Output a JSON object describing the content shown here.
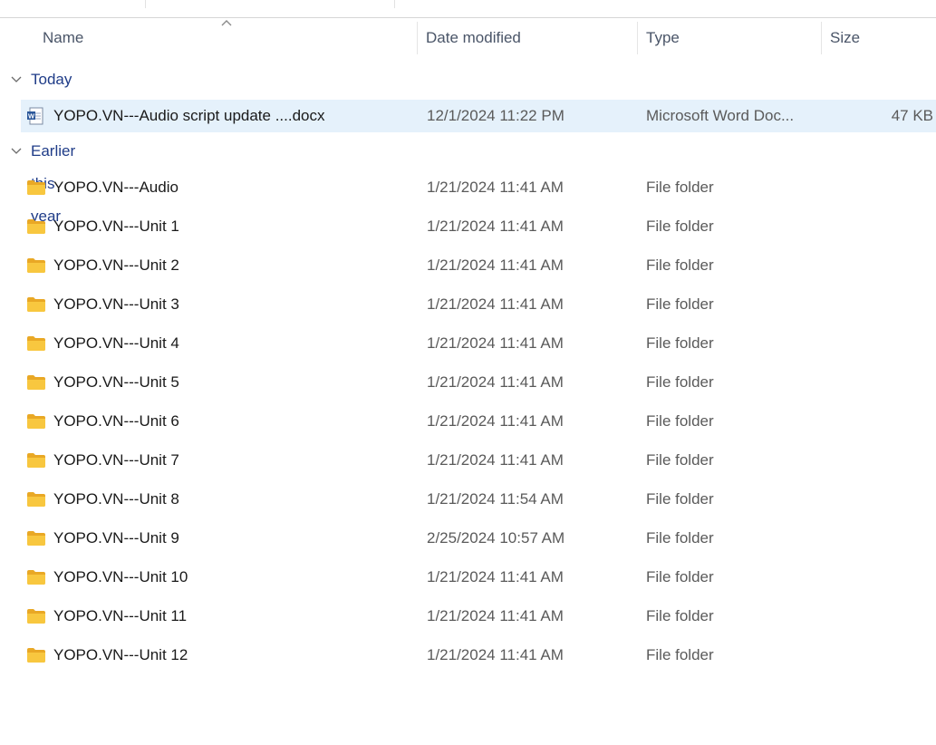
{
  "columns": {
    "name": "Name",
    "date": "Date modified",
    "type": "Type",
    "size": "Size"
  },
  "groups": [
    {
      "label": "Today",
      "items": [
        {
          "name": "YOPO.VN---Audio script update ....docx",
          "date": "12/1/2024 11:22 PM",
          "type": "Microsoft Word Doc...",
          "size": "47 KB",
          "icon": "word-document-icon",
          "selected": true
        }
      ]
    },
    {
      "label": "Earlier this year",
      "items": [
        {
          "name": "YOPO.VN---Audio",
          "date": "1/21/2024 11:41 AM",
          "type": "File folder",
          "size": "",
          "icon": "folder-icon"
        },
        {
          "name": "YOPO.VN---Unit 1",
          "date": "1/21/2024 11:41 AM",
          "type": "File folder",
          "size": "",
          "icon": "folder-icon"
        },
        {
          "name": "YOPO.VN---Unit 2",
          "date": "1/21/2024 11:41 AM",
          "type": "File folder",
          "size": "",
          "icon": "folder-icon"
        },
        {
          "name": "YOPO.VN---Unit 3",
          "date": "1/21/2024 11:41 AM",
          "type": "File folder",
          "size": "",
          "icon": "folder-icon"
        },
        {
          "name": "YOPO.VN---Unit 4",
          "date": "1/21/2024 11:41 AM",
          "type": "File folder",
          "size": "",
          "icon": "folder-icon"
        },
        {
          "name": "YOPO.VN---Unit 5",
          "date": "1/21/2024 11:41 AM",
          "type": "File folder",
          "size": "",
          "icon": "folder-icon"
        },
        {
          "name": "YOPO.VN---Unit 6",
          "date": "1/21/2024 11:41 AM",
          "type": "File folder",
          "size": "",
          "icon": "folder-icon"
        },
        {
          "name": "YOPO.VN---Unit 7",
          "date": "1/21/2024 11:41 AM",
          "type": "File folder",
          "size": "",
          "icon": "folder-icon"
        },
        {
          "name": "YOPO.VN---Unit 8",
          "date": "1/21/2024 11:54 AM",
          "type": "File folder",
          "size": "",
          "icon": "folder-icon"
        },
        {
          "name": "YOPO.VN---Unit 9",
          "date": "2/25/2024 10:57 AM",
          "type": "File folder",
          "size": "",
          "icon": "folder-icon"
        },
        {
          "name": "YOPO.VN---Unit 10",
          "date": "1/21/2024 11:41 AM",
          "type": "File folder",
          "size": "",
          "icon": "folder-icon"
        },
        {
          "name": "YOPO.VN---Unit 11",
          "date": "1/21/2024 11:41 AM",
          "type": "File folder",
          "size": "",
          "icon": "folder-icon"
        },
        {
          "name": "YOPO.VN---Unit 12",
          "date": "1/21/2024 11:41 AM",
          "type": "File folder",
          "size": "",
          "icon": "folder-icon"
        }
      ]
    }
  ],
  "colors": {
    "selection": "#e5f1fb",
    "group_header": "#1f3c88",
    "folder_yellow": "#f8c73f",
    "word_blue": "#2b579a"
  }
}
